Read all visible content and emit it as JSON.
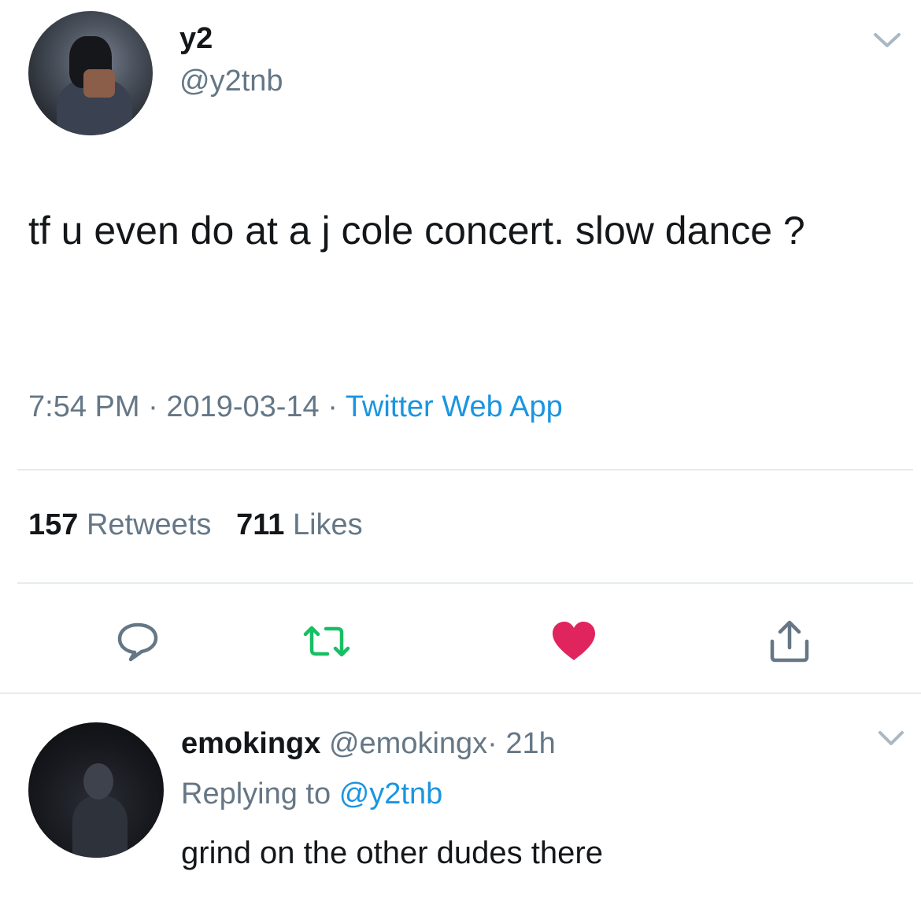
{
  "tweet": {
    "author_name": "y2",
    "author_handle": "@y2tnb",
    "text": "tf u even do at a j cole concert. slow dance ?",
    "time": "7:54 PM",
    "separator": "·",
    "date": "2019-03-14",
    "source": "Twitter Web App",
    "retweet_count": "157",
    "retweet_label": "Retweets",
    "like_count": "711",
    "like_label": "Likes"
  },
  "actions": {
    "reply_icon": "reply-bubble-icon",
    "retweet_icon": "retweet-icon",
    "like_icon": "heart-icon",
    "share_icon": "share-icon",
    "liked": true
  },
  "reply": {
    "author_name": "emokingx",
    "author_handle": "@emokingx",
    "separator": "·",
    "age": "21h",
    "replying_prefix": "Replying to",
    "replying_handle": "@y2tnb",
    "text": "grind on the other dudes there"
  },
  "colors": {
    "text": "#14171a",
    "secondary": "#657786",
    "link": "#1b95e0",
    "retweet_green": "#17bf63",
    "like_red": "#e0245e",
    "divider": "#e6ecf0"
  }
}
